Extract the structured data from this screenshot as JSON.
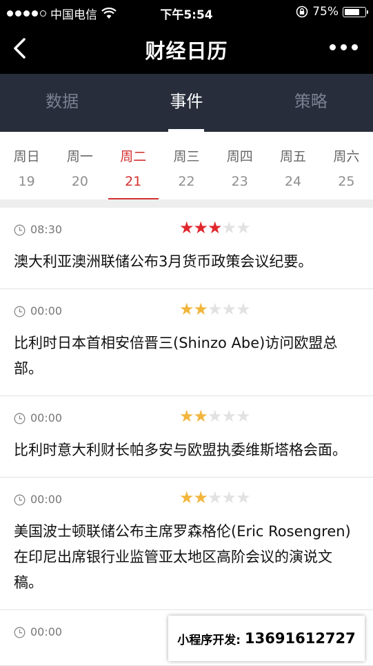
{
  "status_bar": {
    "carrier": "中国电信",
    "time": "下午5:54",
    "battery": "75%",
    "battery_level": 0.75
  },
  "navbar": {
    "title": "财经日历",
    "back_icon": "chevron-left-icon",
    "more_icon": "more-horizontal-icon"
  },
  "tabs": [
    {
      "label": "数据",
      "active": false
    },
    {
      "label": "事件",
      "active": true
    },
    {
      "label": "策略",
      "active": false
    }
  ],
  "days": [
    {
      "weekday": "周日",
      "date": "19",
      "active": false
    },
    {
      "weekday": "周一",
      "date": "20",
      "active": false
    },
    {
      "weekday": "周二",
      "date": "21",
      "active": true
    },
    {
      "weekday": "周三",
      "date": "22",
      "active": false
    },
    {
      "weekday": "周四",
      "date": "23",
      "active": false
    },
    {
      "weekday": "周五",
      "date": "24",
      "active": false
    },
    {
      "weekday": "周六",
      "date": "25",
      "active": false
    }
  ],
  "colors": {
    "star_high": "#e0282e",
    "star_medium": "#f2b63d",
    "star_empty": "#e2e2e2",
    "accent": "#d52e2e"
  },
  "events": [
    {
      "time": "08:30",
      "rating": 3,
      "rating_color": "#e0282e",
      "text": "澳大利亚澳洲联储公布3月货币政策会议纪要。"
    },
    {
      "time": "00:00",
      "rating": 2,
      "rating_color": "#f2b63d",
      "text": "比利时日本首相安倍晋三(Shinzo Abe)访问欧盟总部。"
    },
    {
      "time": "00:00",
      "rating": 2,
      "rating_color": "#f2b63d",
      "text": "比利时意大利财长帕多安与欧盟执委维斯塔格会面。"
    },
    {
      "time": "00:00",
      "rating": 2,
      "rating_color": "#f2b63d",
      "text": "美国波士顿联储公布主席罗森格伦(Eric Rosengren)在印尼出席银行业监管亚太地区高阶会议的演说文稿。"
    },
    {
      "time": "00:00",
      "rating": 2,
      "rating_color": "#f2b63d",
      "text": ""
    }
  ],
  "badge": {
    "label": "小程序开发:",
    "phone": "13691612727"
  }
}
